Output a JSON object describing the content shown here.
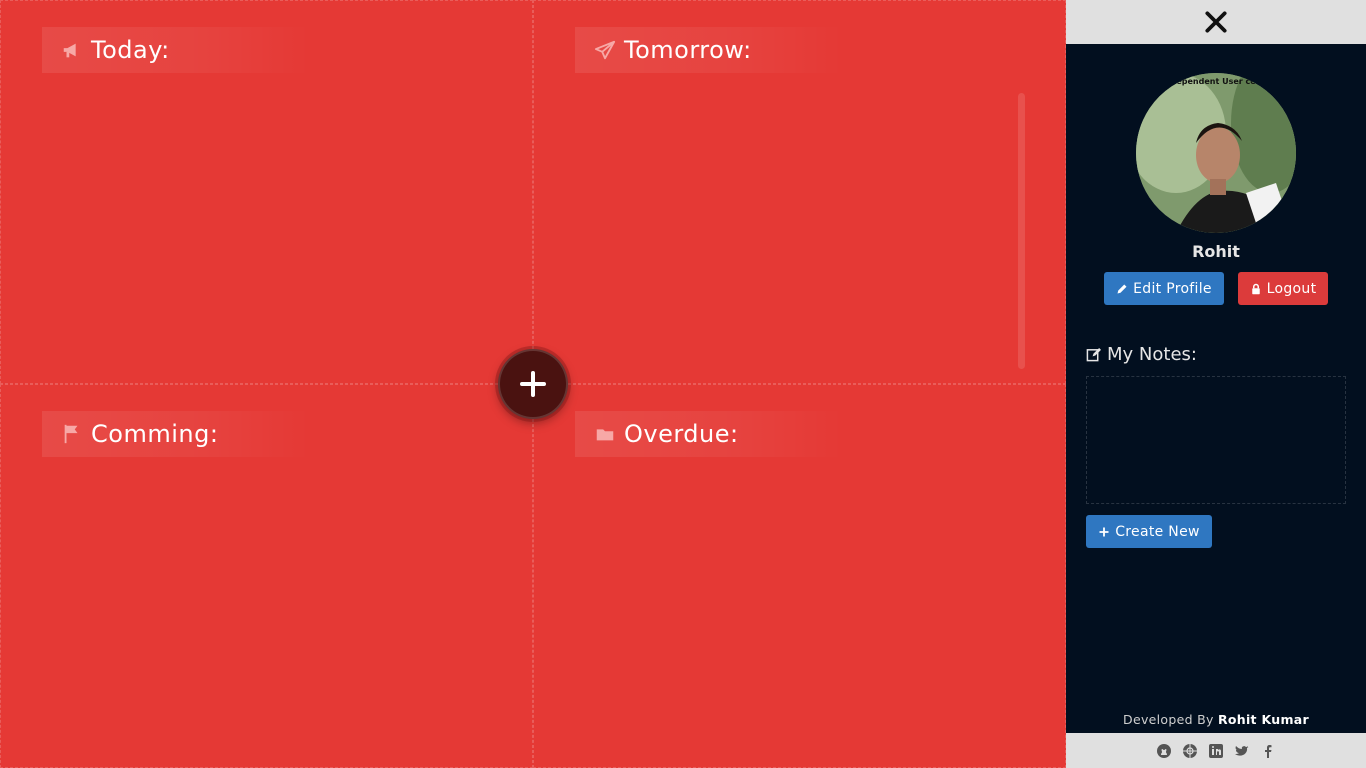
{
  "board": {
    "today": {
      "label": "Today:",
      "icon": "megaphone-icon"
    },
    "tomorrow": {
      "label": "Tomorrow:",
      "icon": "paper-plane-icon"
    },
    "coming": {
      "label": "Comming:",
      "icon": "flag-icon"
    },
    "overdue": {
      "label": "Overdue:",
      "icon": "folder-icon"
    },
    "add_button_icon": "plus-icon"
  },
  "sidebar": {
    "close_icon": "close-icon",
    "avatar_caption": "ependent User ce",
    "user_name": "Rohit",
    "edit_profile_label": "Edit Profile",
    "logout_label": "Logout",
    "notes_title": "My Notes:",
    "create_new_label": "Create New",
    "credit_prefix": "Developed By",
    "credit_name": "Rohit Kumar",
    "social_icons": [
      "github-icon",
      "globe-icon",
      "linkedin-icon",
      "twitter-icon",
      "facebook-icon"
    ]
  },
  "colors": {
    "board_bg": "#e53935",
    "panel_bg": "#020f1f",
    "primary_button": "#2f77c1",
    "danger_button": "#dc3b3b",
    "fab_bg": "#4a1210"
  }
}
